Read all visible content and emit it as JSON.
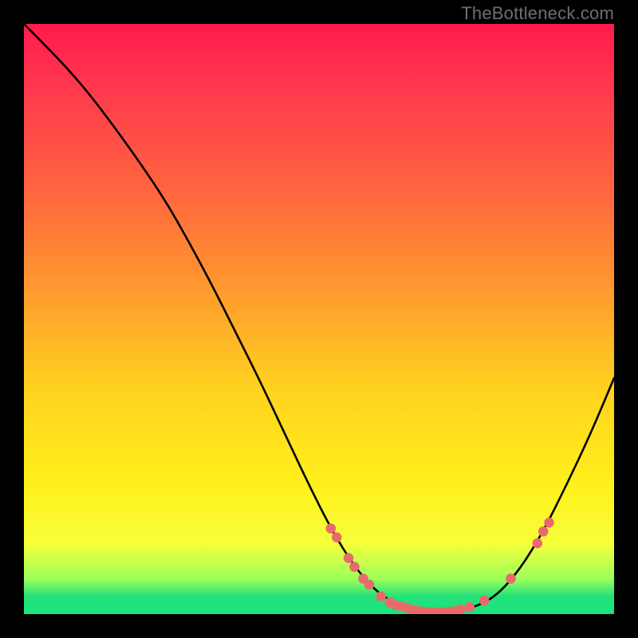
{
  "attribution": "TheBottleneck.com",
  "chart_data": {
    "type": "line",
    "title": "",
    "xlabel": "",
    "ylabel": "",
    "xlim": [
      0,
      100
    ],
    "ylim": [
      0,
      100
    ],
    "grid": false,
    "legend": false,
    "series": [
      {
        "name": "curve",
        "color": "#000000",
        "x": [
          0,
          5,
          10,
          15,
          20,
          24,
          28,
          32,
          36,
          40,
          44,
          48,
          52,
          56,
          60,
          64,
          68,
          72,
          76,
          80,
          84,
          88,
          92,
          96,
          100
        ],
        "y": [
          100,
          95,
          89.5,
          83,
          76,
          70,
          63,
          55.5,
          47.5,
          39.5,
          31,
          22.5,
          14.5,
          8,
          3.5,
          1.3,
          0.4,
          0.3,
          1,
          3,
          7.5,
          14,
          22,
          30.5,
          40
        ]
      }
    ],
    "points": {
      "name": "markers",
      "color": "#e86b6b",
      "radius_pct": 0.85,
      "xy": [
        [
          52,
          14.5
        ],
        [
          53,
          13
        ],
        [
          55,
          9.5
        ],
        [
          56,
          8
        ],
        [
          57.5,
          6
        ],
        [
          58.5,
          5
        ],
        [
          60.5,
          3
        ],
        [
          62,
          2
        ],
        [
          63,
          1.5
        ],
        [
          64,
          1.3
        ],
        [
          65,
          1
        ],
        [
          66,
          0.7
        ],
        [
          67,
          0.5
        ],
        [
          68,
          0.4
        ],
        [
          69,
          0.3
        ],
        [
          70,
          0.3
        ],
        [
          71,
          0.3
        ],
        [
          72,
          0.4
        ],
        [
          73,
          0.5
        ],
        [
          74,
          0.8
        ],
        [
          75.5,
          1.2
        ],
        [
          78,
          2.3
        ],
        [
          82.5,
          6
        ],
        [
          87,
          12
        ],
        [
          88,
          14
        ],
        [
          89,
          15.5
        ]
      ]
    }
  }
}
